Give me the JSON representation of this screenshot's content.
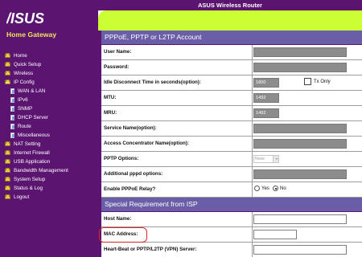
{
  "header": {
    "title": "ASUS Wireless Router",
    "logo_text": "/ISUS",
    "subtitle": "Home Gateway"
  },
  "sidebar": {
    "items": [
      {
        "label": "Home",
        "type": "folder"
      },
      {
        "label": "Quick Setup",
        "type": "folder"
      },
      {
        "label": "Wireless",
        "type": "folder"
      },
      {
        "label": "IP Config",
        "type": "folder-open"
      },
      {
        "label": "WAN & LAN",
        "type": "page"
      },
      {
        "label": "IPv6",
        "type": "page"
      },
      {
        "label": "SNMP",
        "type": "page"
      },
      {
        "label": "DHCP Server",
        "type": "page"
      },
      {
        "label": "Route",
        "type": "page"
      },
      {
        "label": "Miscellaneous",
        "type": "page"
      },
      {
        "label": "NAT Setting",
        "type": "folder"
      },
      {
        "label": "Internet Firewall",
        "type": "folder"
      },
      {
        "label": "USB Application",
        "type": "folder"
      },
      {
        "label": "Bandwidth Management",
        "type": "folder"
      },
      {
        "label": "System Setup",
        "type": "folder"
      },
      {
        "label": "Status & Log",
        "type": "folder"
      },
      {
        "label": "Logout",
        "type": "folder"
      }
    ]
  },
  "pppoe": {
    "section_title": "PPPoE, PPTP or L2TP Account",
    "user_name_label": "User Name:",
    "password_label": "Password:",
    "idle_label": "Idle Disconnect Time in seconds(option):",
    "idle_value": "1800",
    "tx_only_label": "Tx Only",
    "tx_only_checked": false,
    "mtu_label": "MTU:",
    "mtu_value": "1492",
    "mru_label": "MRU:",
    "mru_value": "1492",
    "service_name_label": "Service Name(option):",
    "ac_name_label": "Access Concentrator Name(option):",
    "pptp_options_label": "PPTP Options:",
    "pptp_options_value": "None",
    "additional_pppd_label": "Additional pppd options:",
    "relay_label": "Enable PPPoE Relay?",
    "relay_yes": "Yes",
    "relay_no": "No",
    "relay_selected": "No"
  },
  "isp": {
    "section_title": "Special Requirement from ISP",
    "host_name_label": "Host Name:",
    "mac_address_label": "MAC Address:",
    "heartbeat_label": "Heart-Beat or PPTP/L2TP (VPN) Server:"
  },
  "colors": {
    "sidebar_bg": "#5b1470",
    "accent_green": "#ccff33",
    "section_header": "#6b5ea8",
    "highlight": "#d9252a",
    "subtitle": "#f3e75a"
  }
}
